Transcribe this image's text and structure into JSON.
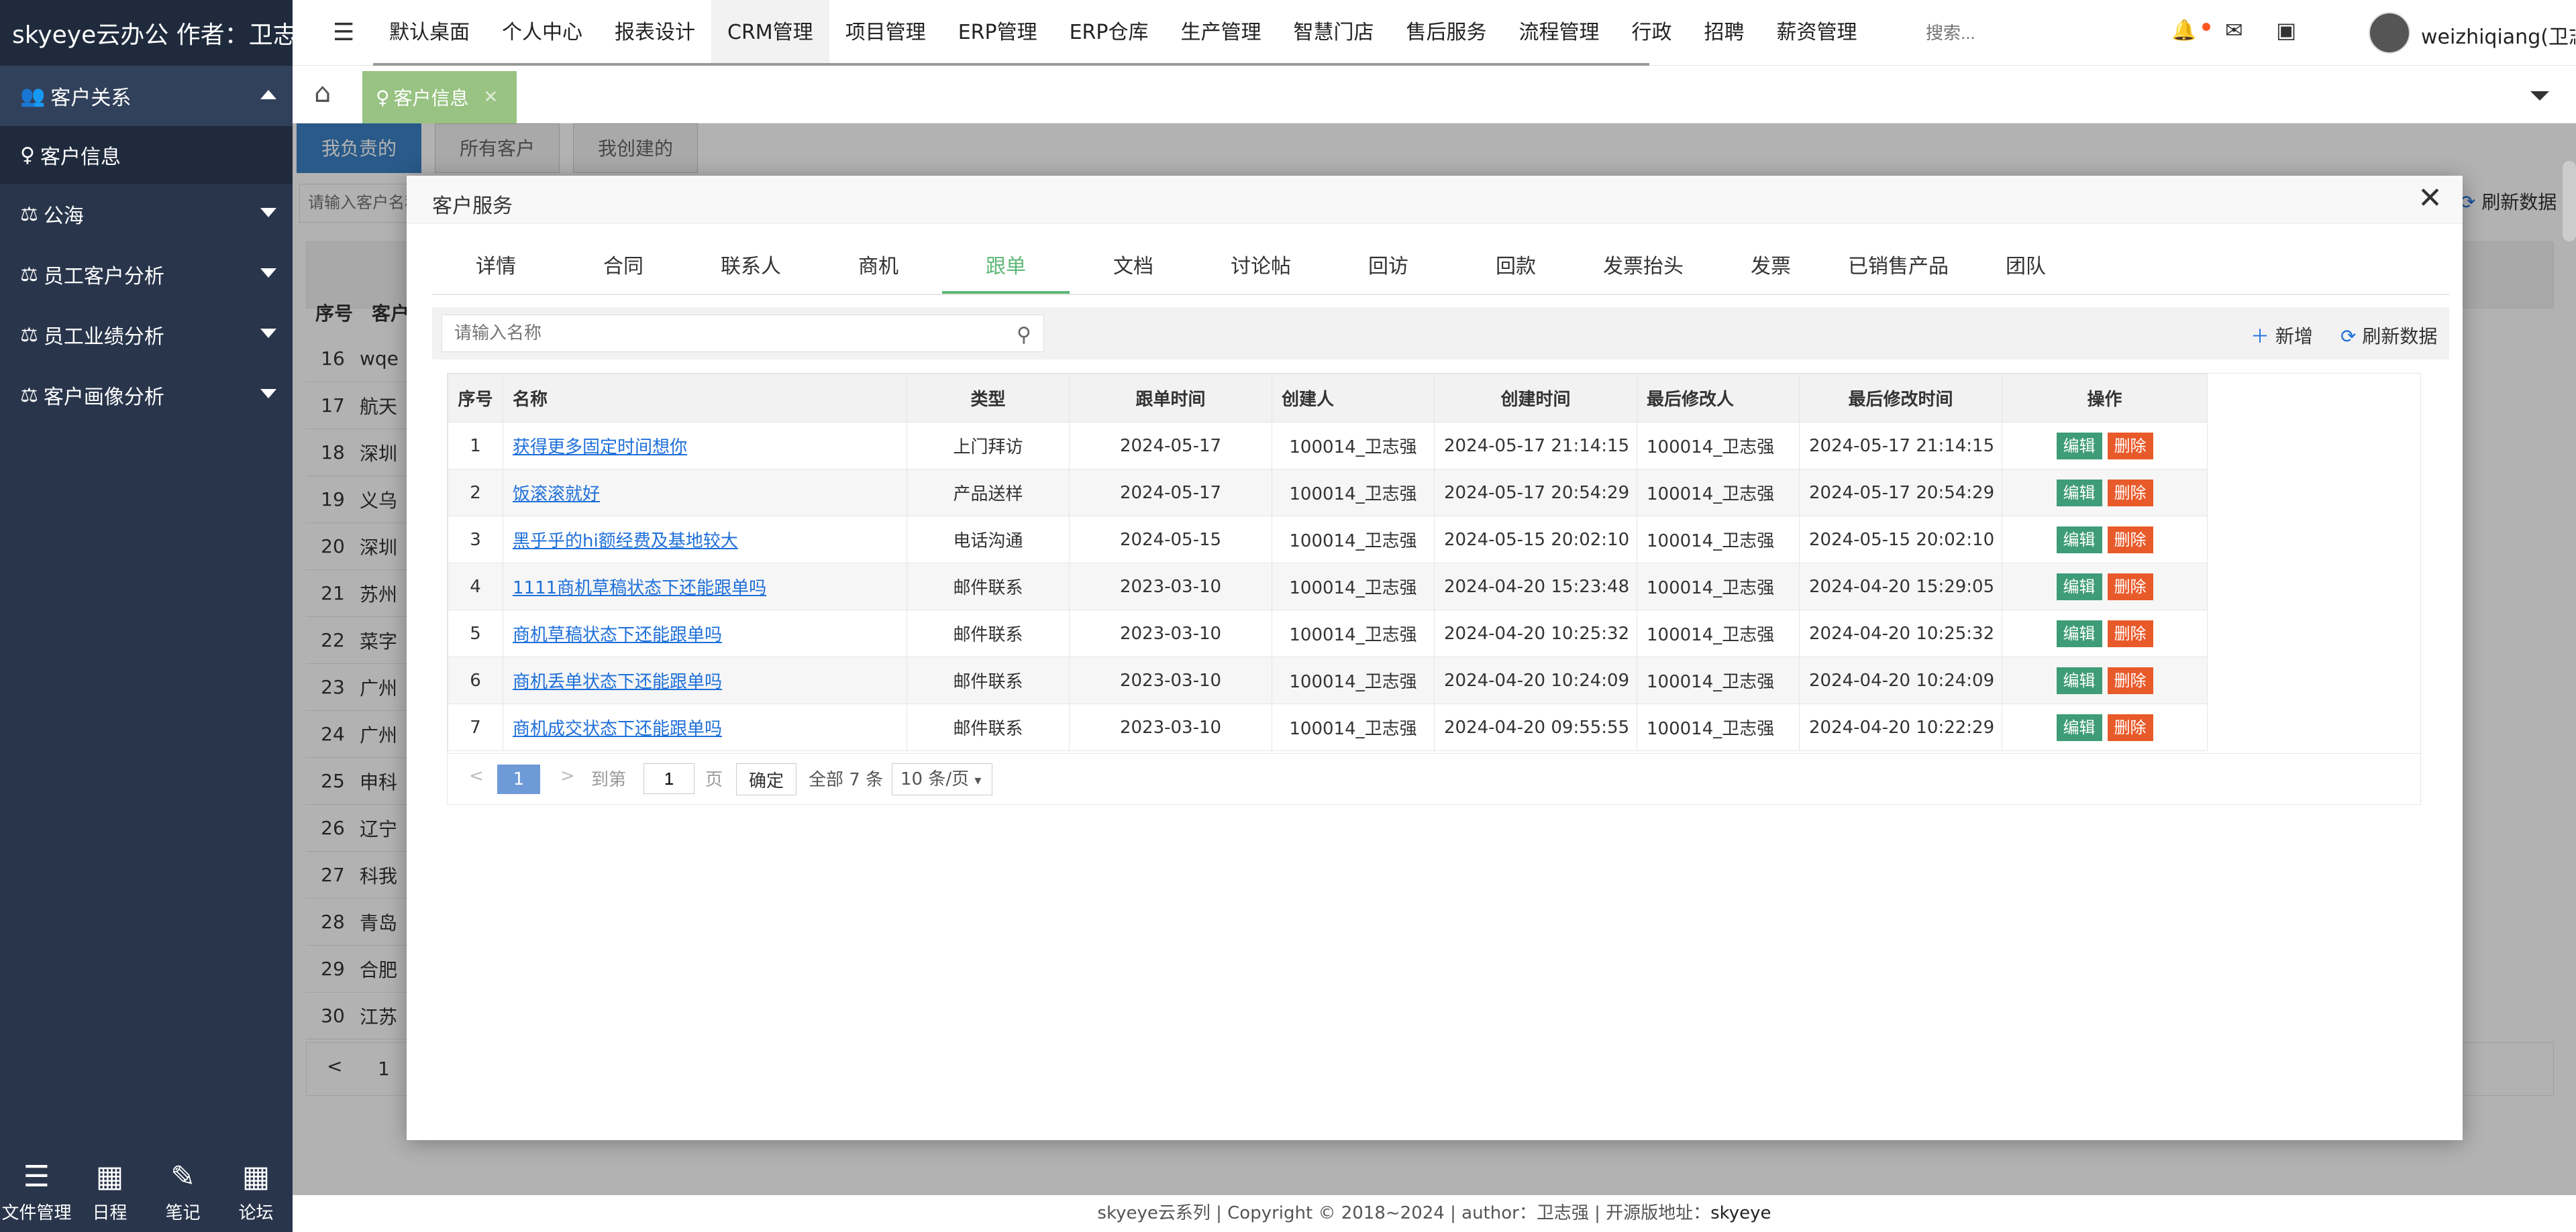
{
  "sidebar": {
    "brand": "skyeye云办公 作者：卫志强",
    "groups": [
      {
        "label": "客户关系",
        "icon": "users-icon"
      },
      {
        "label": "公海",
        "icon": "scale-icon"
      },
      {
        "label": "员工客户分析",
        "icon": "scale-icon"
      },
      {
        "label": "员工业绩分析",
        "icon": "scale-icon"
      },
      {
        "label": "客户画像分析",
        "icon": "scale-icon"
      }
    ],
    "subitem": "客户信息",
    "bottom": [
      {
        "label": "文件管理",
        "icon": "list-icon"
      },
      {
        "label": "日程",
        "icon": "calendar-icon"
      },
      {
        "label": "笔记",
        "icon": "edit-icon"
      },
      {
        "label": "论坛",
        "icon": "calendar-icon"
      }
    ]
  },
  "topnav": {
    "items": [
      "默认桌面",
      "个人中心",
      "报表设计",
      "CRM管理",
      "项目管理",
      "ERP管理",
      "ERP仓库",
      "生产管理",
      "智慧门店",
      "售后服务",
      "流程管理",
      "行政",
      "招聘",
      "薪资管理"
    ],
    "search_placeholder": "搜索...",
    "username": "weizhiqiang(卫志强)"
  },
  "tabbar": {
    "active_tab": "客户信息"
  },
  "bgpage": {
    "tabs": [
      "我负责的",
      "所有客户",
      "我创建的"
    ],
    "search_placeholder": "请输入客户名称",
    "refresh": "刷新数据",
    "headers": [
      "序号",
      "客户"
    ],
    "rows": [
      {
        "no": "16",
        "name": "wqe"
      },
      {
        "no": "17",
        "name": "航天"
      },
      {
        "no": "18",
        "name": "深圳"
      },
      {
        "no": "19",
        "name": "义乌"
      },
      {
        "no": "20",
        "name": "深圳"
      },
      {
        "no": "21",
        "name": "苏州"
      },
      {
        "no": "22",
        "name": "菜字"
      },
      {
        "no": "23",
        "name": "广州"
      },
      {
        "no": "24",
        "name": "广州"
      },
      {
        "no": "25",
        "name": "申科"
      },
      {
        "no": "26",
        "name": "辽宁"
      },
      {
        "no": "27",
        "name": "科我"
      },
      {
        "no": "28",
        "name": "青岛"
      },
      {
        "no": "29",
        "name": "合肥"
      },
      {
        "no": "30",
        "name": "江苏"
      }
    ],
    "pager": {
      "prev": "<",
      "page": "1"
    }
  },
  "modal": {
    "title": "客户服务",
    "tabs": [
      "详情",
      "合同",
      "联系人",
      "商机",
      "跟单",
      "文档",
      "讨论帖",
      "回访",
      "回款",
      "发票抬头",
      "发票",
      "已销售产品",
      "团队"
    ],
    "active_tab_index": 4,
    "search_placeholder": "请输入名称",
    "add_label": "新增",
    "refresh_label": "刷新数据",
    "table": {
      "headers": [
        "序号",
        "名称",
        "类型",
        "跟单时间",
        "创建人",
        "创建时间",
        "最后修改人",
        "最后修改时间",
        "操作"
      ],
      "rows": [
        {
          "no": "1",
          "name": "获得更多固定时间想你",
          "type": "上门拜访",
          "follow_time": "2024-05-17",
          "creator": "100014_卫志强",
          "created": "2024-05-17 21:14:15",
          "modifier": "100014_卫志强",
          "modified": "2024-05-17 21:14:15"
        },
        {
          "no": "2",
          "name": "饭滚滚就好",
          "type": "产品送样",
          "follow_time": "2024-05-17",
          "creator": "100014_卫志强",
          "created": "2024-05-17 20:54:29",
          "modifier": "100014_卫志强",
          "modified": "2024-05-17 20:54:29"
        },
        {
          "no": "3",
          "name": "黑乎乎的hi额经费及基地较大",
          "type": "电话沟通",
          "follow_time": "2024-05-15",
          "creator": "100014_卫志强",
          "created": "2024-05-15 20:02:10",
          "modifier": "100014_卫志强",
          "modified": "2024-05-15 20:02:10"
        },
        {
          "no": "4",
          "name": "1111商机草稿状态下还能跟单吗",
          "type": "邮件联系",
          "follow_time": "2023-03-10",
          "creator": "100014_卫志强",
          "created": "2024-04-20 15:23:48",
          "modifier": "100014_卫志强",
          "modified": "2024-04-20 15:29:05"
        },
        {
          "no": "5",
          "name": "商机草稿状态下还能跟单吗",
          "type": "邮件联系",
          "follow_time": "2023-03-10",
          "creator": "100014_卫志强",
          "created": "2024-04-20 10:25:32",
          "modifier": "100014_卫志强",
          "modified": "2024-04-20 10:25:32"
        },
        {
          "no": "6",
          "name": "商机丢单状态下还能跟单吗",
          "type": "邮件联系",
          "follow_time": "2023-03-10",
          "creator": "100014_卫志强",
          "created": "2024-04-20 10:24:09",
          "modifier": "100014_卫志强",
          "modified": "2024-04-20 10:24:09"
        },
        {
          "no": "7",
          "name": "商机成交状态下还能跟单吗",
          "type": "邮件联系",
          "follow_time": "2023-03-10",
          "creator": "100014_卫志强",
          "created": "2024-04-20 09:55:55",
          "modifier": "100014_卫志强",
          "modified": "2024-04-20 10:22:29"
        }
      ],
      "edit_label": "编辑",
      "delete_label": "删除"
    },
    "pager": {
      "prev": "<",
      "next": ">",
      "current": "1",
      "goto_label": "到第",
      "goto_value": "1",
      "page_unit": "页",
      "confirm": "确定",
      "total": "全部 7 条",
      "page_size": "10 条/页"
    }
  },
  "footer": {
    "text": "skyeye云系列 | Copyright © 2018~2024 | author：卫志强 | 开源版地址：",
    "link": "skyeye"
  },
  "colors": {
    "sidebar": "#28354b",
    "active_tab": "#5fb878",
    "tab_chip": "#98c383",
    "edit": "#3e9c78",
    "delete": "#e85a2a",
    "link": "#1e6fd9"
  }
}
